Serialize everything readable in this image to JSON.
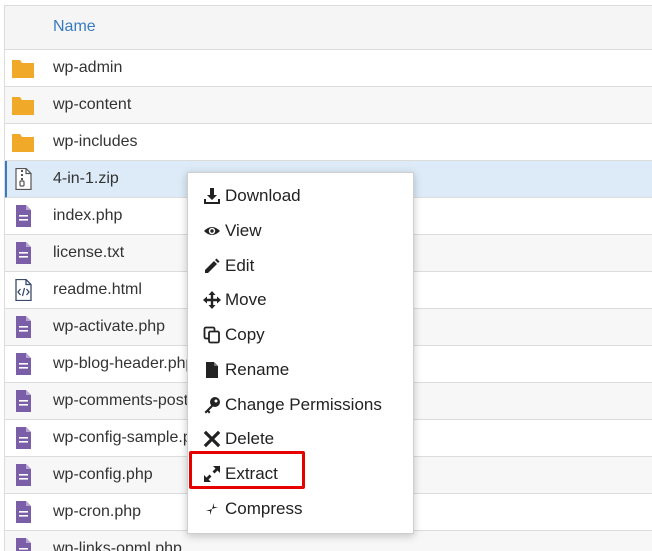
{
  "table": {
    "name_header": "Name",
    "rows": [
      {
        "name": "wp-admin",
        "type": "folder"
      },
      {
        "name": "wp-content",
        "type": "folder"
      },
      {
        "name": "wp-includes",
        "type": "folder"
      },
      {
        "name": "4-in-1.zip",
        "type": "zip"
      },
      {
        "name": "index.php",
        "type": "file"
      },
      {
        "name": "license.txt",
        "type": "file"
      },
      {
        "name": "readme.html",
        "type": "code"
      },
      {
        "name": "wp-activate.php",
        "type": "file"
      },
      {
        "name": "wp-blog-header.php",
        "type": "file"
      },
      {
        "name": "wp-comments-post.php",
        "type": "file"
      },
      {
        "name": "wp-config-sample.php",
        "type": "file"
      },
      {
        "name": "wp-config.php",
        "type": "file"
      },
      {
        "name": "wp-cron.php",
        "type": "file"
      },
      {
        "name": "wp-links-opml.php",
        "type": "file"
      }
    ]
  },
  "context_menu": {
    "items": [
      {
        "label": "Download",
        "icon": "download-icon"
      },
      {
        "label": "View",
        "icon": "eye-icon"
      },
      {
        "label": "Edit",
        "icon": "pencil-icon"
      },
      {
        "label": "Move",
        "icon": "move-icon"
      },
      {
        "label": "Copy",
        "icon": "copy-icon"
      },
      {
        "label": "Rename",
        "icon": "file-icon"
      },
      {
        "label": "Change Permissions",
        "icon": "key-icon"
      },
      {
        "label": "Delete",
        "icon": "x-icon"
      },
      {
        "label": "Extract",
        "icon": "expand-icon"
      },
      {
        "label": "Compress",
        "icon": "compress-icon"
      }
    ]
  },
  "colors": {
    "folder": "#f0a929",
    "file": "#7a5ea8",
    "accent": "#3a7bbf",
    "highlight": "#e60000"
  }
}
